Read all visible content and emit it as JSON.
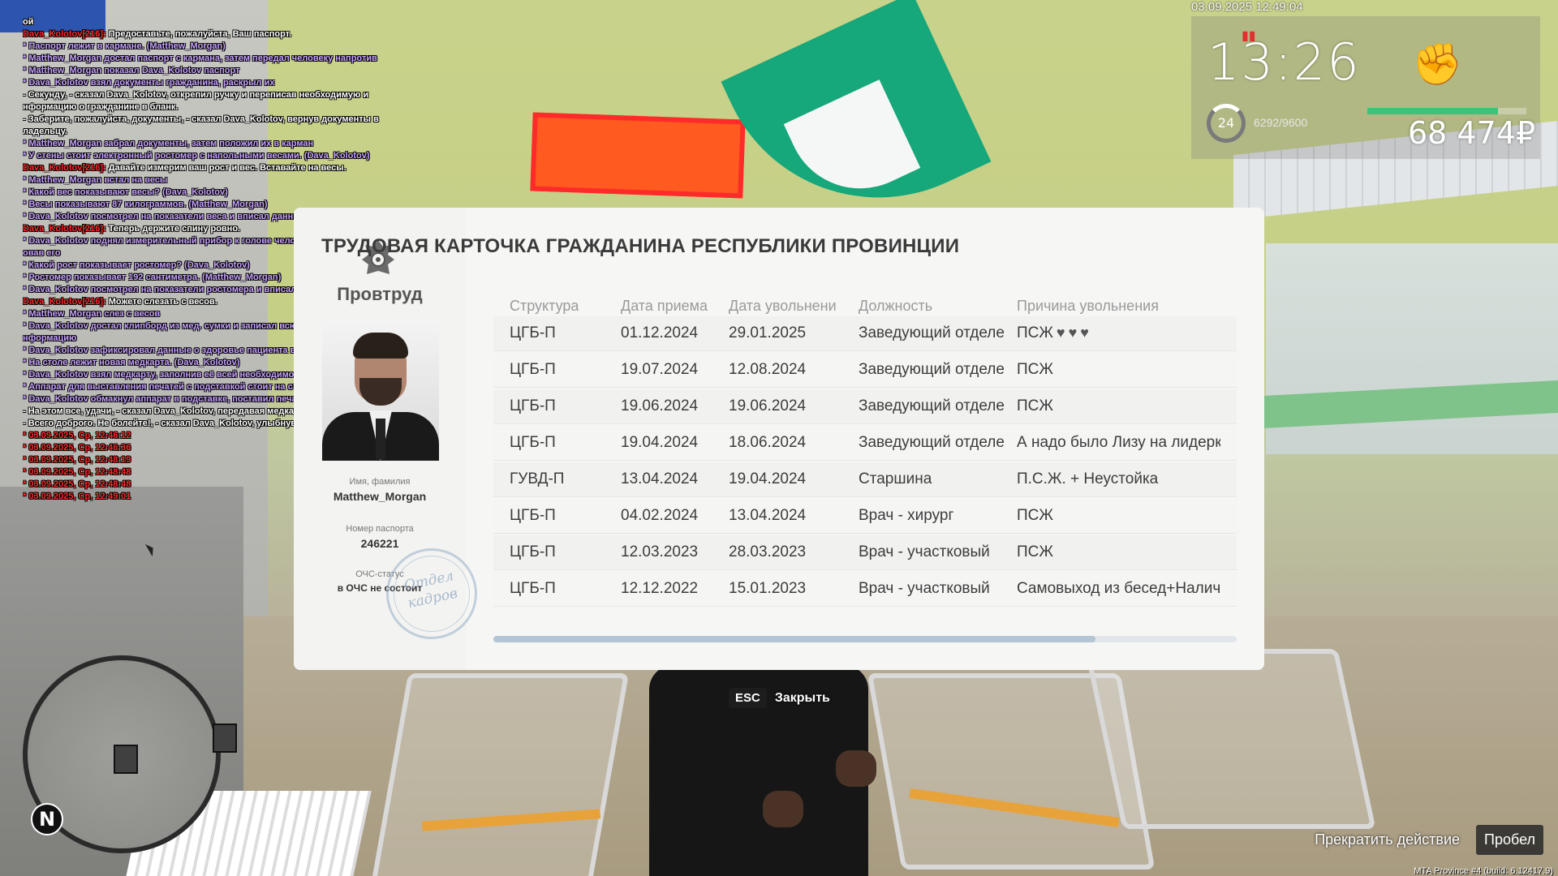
{
  "chat": [
    {
      "type": "w",
      "text": "ой"
    },
    {
      "type": "n",
      "nick": "Dava_Kolotov[216]:",
      "text": " Предоставьте, пожалуйста, Ваш паспорт."
    },
    {
      "type": "p",
      "text": "* Паспорт лежит в кармане. (Matthew_Morgan)"
    },
    {
      "type": "p",
      "text": "* Matthew_Morgan достал паспорт с кармана, затем передал человеку напротив"
    },
    {
      "type": "p",
      "text": "* Matthew_Morgan показал Dava_Kolotov паспорт"
    },
    {
      "type": "p",
      "text": "* Dava_Kolotov взял документы гражданина, раскрыл их"
    },
    {
      "type": "w",
      "text": "- Секунду, - сказал Dava_Kolotov, открепил ручку и переписав необходимую и"
    },
    {
      "type": "w",
      "text": "нформацию о гражданине в бланк."
    },
    {
      "type": "w",
      "text": "- Заберите, пожалуйста, документы, - сказал Dava_Kolotov, вернув документы в"
    },
    {
      "type": "w",
      "text": "ладельцу."
    },
    {
      "type": "p",
      "text": "* Matthew_Morgan забрал документы, затем положил их в карман"
    },
    {
      "type": "p",
      "text": "* У стены стоит электронный ростомер с напольными весами. (Dava_Kolotov)"
    },
    {
      "type": "n",
      "nick": "Dava_Kolotov[216]:",
      "text": " Давайте измерим ваш рост и вес. Вставайте на весы."
    },
    {
      "type": "p",
      "text": "* Matthew_Morgan встал на весы"
    },
    {
      "type": "p",
      "text": "* Какой вес показывают весы? (Dava_Kolotov)"
    },
    {
      "type": "p",
      "text": "* Весы показывают 87 килограммов. (Matthew_Morgan)"
    },
    {
      "type": "p",
      "text": "* Dava_Kolotov посмотрел на показатели веса и вписал данные в бланк"
    },
    {
      "type": "n",
      "nick": "Dava_Kolotov[216]:",
      "text": " Теперь держите спину ровно."
    },
    {
      "type": "p",
      "text": "* Dava_Kolotov поднял измерительный прибор к голове человека, зафиксир"
    },
    {
      "type": "p",
      "text": "овав его"
    },
    {
      "type": "p",
      "text": "* Какой рост показывает ростомер? (Dava_Kolotov)"
    },
    {
      "type": "p",
      "text": "* Ростомер показывает 192 сантиметра. (Matthew_Morgan)"
    },
    {
      "type": "p",
      "text": "* Dava_Kolotov посмотрел на показатели ростомера и вписал данные в бланк"
    },
    {
      "type": "n",
      "nick": "Dava_Kolotov[216]:",
      "text": " Можете слезать с весов."
    },
    {
      "type": "p",
      "text": "* Matthew_Morgan слез с весов"
    },
    {
      "type": "p",
      "text": "* Dava_Kolotov достал клипборд из мед. сумки и записал всю необходимую и"
    },
    {
      "type": "p",
      "text": "нформацию"
    },
    {
      "type": "p",
      "text": "* Dava_Kolotov зафиксировал данные о здоровье пациента в бланк"
    },
    {
      "type": "p",
      "text": "* На столе лежит новая медкарта. (Dava_Kolotov)"
    },
    {
      "type": "p",
      "text": "* Dava_Kolotov взял медкарту, заполнив её всей необходимой информацией"
    },
    {
      "type": "p",
      "text": "* Аппарат для выставления печатей с подставкой стоит на столе. (Dava_Kolotov)"
    },
    {
      "type": "p",
      "text": "* Dava_Kolotov обмакнул аппарат в подставке, поставил печать"
    },
    {
      "type": "w",
      "text": "- На этом все, удачи, - сказал Dava_Kolotov, передавая медкарту гражданину."
    },
    {
      "type": "w",
      "text": "- Всего доброго. Не болейте!, - сказал Dava_Kolotov, улыбнувшись."
    },
    {
      "type": "r",
      "text": "* 03.09.2025, Ср, 12:46:12"
    },
    {
      "type": "r",
      "text": "* 03.09.2025, Ср, 12:46:36"
    },
    {
      "type": "r",
      "text": "* 03.09.2025, Ср, 12:48:19"
    },
    {
      "type": "r",
      "text": "* 03.09.2025, Ср, 12:48:48"
    },
    {
      "type": "r",
      "text": "* 03.09.2025, Ср, 12:48:48"
    },
    {
      "type": "r",
      "text": "* 03.09.2025, Ср, 12:49:01"
    }
  ],
  "hud": {
    "datetime": "03.09.2025 12:49:04",
    "time": "13:26",
    "signal_icon": "signal-bars-icon",
    "level": "24",
    "xp": "6292/9600",
    "health_fraction": 0.82,
    "money": "68 474₽",
    "fist_icon": "fist-icon"
  },
  "minimap": {
    "north_label": "N"
  },
  "card": {
    "title": "ТРУДОВАЯ КАРТОЧКА ГРАЖДАНИНА РЕСПУБЛИКИ ПРОВИНЦИИ",
    "ministry": "Провтруд",
    "name_label": "Имя, фамилия",
    "name_value": "Matthew_Morgan",
    "passport_label": "Номер паспорта",
    "passport_value": "246221",
    "ochs_label": "ОЧС-статус",
    "ochs_value": "в ОЧС не состоит",
    "stamp_text": "Отдел кадров",
    "columns": [
      "Структура",
      "Дата приема",
      "Дата увольнени",
      "Должность",
      "Причина увольнения"
    ],
    "rows": [
      {
        "structure": "ЦГБ-П",
        "hired": "01.12.2024",
        "fired": "29.01.2025",
        "position": "Заведующий отделе",
        "reason": "ПСЖ",
        "hearts": 3
      },
      {
        "structure": "ЦГБ-П",
        "hired": "19.07.2024",
        "fired": "12.08.2024",
        "position": "Заведующий отделе",
        "reason": "ПСЖ",
        "hearts": 0
      },
      {
        "structure": "ЦГБ-П",
        "hired": "19.06.2024",
        "fired": "19.06.2024",
        "position": "Заведующий отделе",
        "reason": "ПСЖ",
        "hearts": 0
      },
      {
        "structure": "ЦГБ-П",
        "hired": "19.04.2024",
        "fired": "18.06.2024",
        "position": "Заведующий отделе",
        "reason": "А надо было Лизу на лидерк",
        "hearts": 0
      },
      {
        "structure": "ГУВД-П",
        "hired": "13.04.2024",
        "fired": "19.04.2024",
        "position": "Старшина",
        "reason": "П.С.Ж. + Неустойка",
        "hearts": 0
      },
      {
        "structure": "ЦГБ-П",
        "hired": "04.02.2024",
        "fired": "13.04.2024",
        "position": "Врач - хирург",
        "reason": "ПСЖ",
        "hearts": 0
      },
      {
        "structure": "ЦГБ-П",
        "hired": "12.03.2023",
        "fired": "28.03.2023",
        "position": "Врач - участковый",
        "reason": "ПСЖ",
        "hearts": 0
      },
      {
        "structure": "ЦГБ-П",
        "hired": "12.12.2022",
        "fired": "15.01.2023",
        "position": "Врач - участковый",
        "reason": "Самовыход из бесед+Наличи",
        "hearts": 0
      }
    ],
    "scroll_fraction": 0.81
  },
  "esc_hint": {
    "key": "ESC",
    "label": "Закрыть"
  },
  "actions": {
    "stop_label": "Прекратить действие",
    "key_label": "Пробел"
  },
  "build_info": "MTA Province #4 (build: 6.12417.9)"
}
